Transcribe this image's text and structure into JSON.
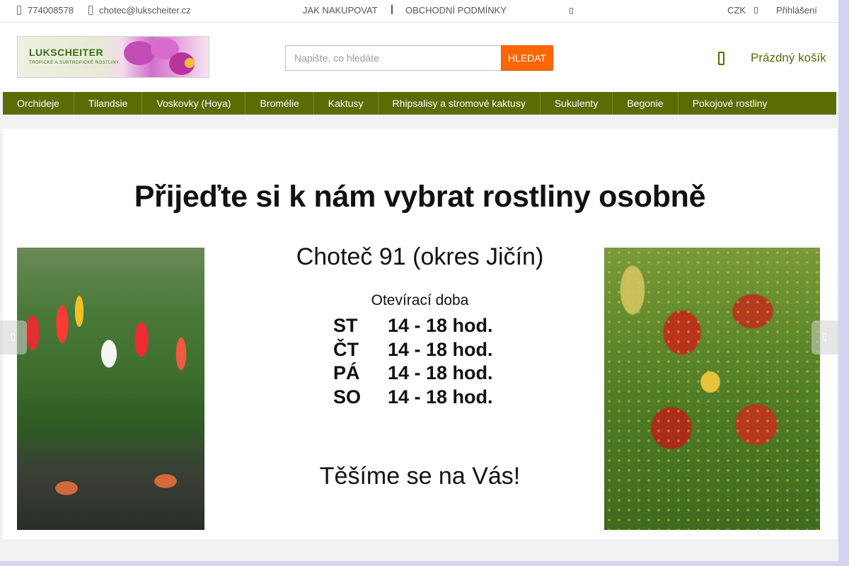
{
  "topbar": {
    "phone": "774008578",
    "email": "chotec@lukscheiter.cz",
    "links": [
      "JAK NAKUPOVAT",
      "OBCHODNÍ PODMÍNKY"
    ],
    "currency": "CZK",
    "login": "Přihlášení"
  },
  "header": {
    "logo_name": "LUKSCHEITER",
    "logo_tagline": "TROPICKÉ A SUBTROPICKÉ ROSTLINY",
    "search_placeholder": "Napište, co hledáte",
    "search_button": "HLEDAT",
    "cart_label": "Prázdný košík"
  },
  "nav": {
    "items": [
      "Orchideje",
      "Tilandsie",
      "Voskovky (Hoya)",
      "Bromélie",
      "Kaktusy",
      "Rhipsalisy a stromové kaktusy",
      "Sukulenty",
      "Begonie",
      "Pokojové rostliny"
    ]
  },
  "banner": {
    "title": "Přijeďte si k nám vybrat rostliny osobně",
    "address": "Choteč 91 (okres Jičín)",
    "hours_title": "Otevírací doba",
    "hours": [
      {
        "day": "ST",
        "time": "14 - 18 hod."
      },
      {
        "day": "ČT",
        "time": "14 - 18 hod."
      },
      {
        "day": "PÁ",
        "time": "14 - 18 hod."
      },
      {
        "day": "SO",
        "time": "14 - 18 hod."
      }
    ],
    "closing": "Těšíme se na Vás!"
  },
  "colors": {
    "accent_orange": "#ff6600",
    "nav_green": "#5b6c05",
    "cart_olive": "#5a6a00"
  },
  "icons": {
    "phone": "phone-icon",
    "email": "email-icon",
    "currency_dropdown": "chevron-down-icon",
    "cart": "cart-icon",
    "prev": "chevron-left-icon",
    "next": "chevron-right-icon"
  }
}
